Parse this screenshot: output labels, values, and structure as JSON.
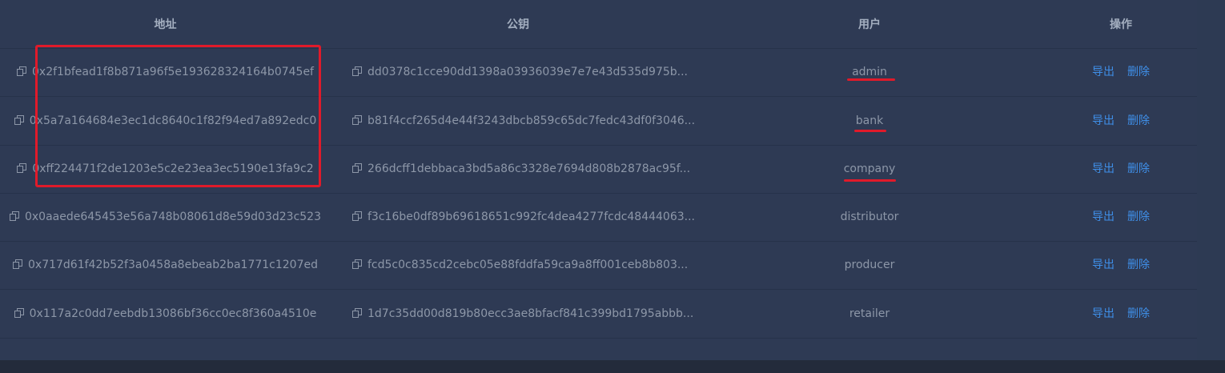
{
  "table": {
    "headers": {
      "address": "地址",
      "public_key": "公钥",
      "user": "用户",
      "actions": "操作"
    },
    "rows": [
      {
        "address": "0x2f1bfead1f8b871a96f5e193628324164b0745ef",
        "public_key": "dd0378c1cce90dd1398a03936039e7e7e43d535d975b...",
        "user": "admin",
        "export_label": "导出",
        "delete_label": "删除"
      },
      {
        "address": "0x5a7a164684e3ec1dc8640c1f82f94ed7a892edc0",
        "public_key": "b81f4ccf265d4e44f3243dbcb859c65dc7fedc43df0f3046...",
        "user": "bank",
        "export_label": "导出",
        "delete_label": "删除"
      },
      {
        "address": "0xff224471f2de1203e5c2e23ea3ec5190e13fa9c2",
        "public_key": "266dcff1debbaca3bd5a86c3328e7694d808b2878ac95f...",
        "user": "company",
        "export_label": "导出",
        "delete_label": "删除"
      },
      {
        "address": "0x0aaede645453e56a748b08061d8e59d03d23c523",
        "public_key": "f3c16be0df89b69618651c992fc4dea4277fcdc48444063...",
        "user": "distributor",
        "export_label": "导出",
        "delete_label": "删除"
      },
      {
        "address": "0x717d61f42b52f3a0458a8ebeab2ba1771c1207ed",
        "public_key": "fcd5c0c835cd2cebc05e88fddfa59ca9a8ff001ceb8b803...",
        "user": "producer",
        "export_label": "导出",
        "delete_label": "删除"
      },
      {
        "address": "0x117a2c0dd7eebdb13086bf36cc0ec8f360a4510e",
        "public_key": "1d7c35dd00d819b80ecc3ae8bfacf841c399bd1795abbb...",
        "user": "retailer",
        "export_label": "导出",
        "delete_label": "删除"
      }
    ]
  },
  "annotations": {
    "highlight_color": "#e01a2a",
    "link_color": "#3f8fe8"
  }
}
